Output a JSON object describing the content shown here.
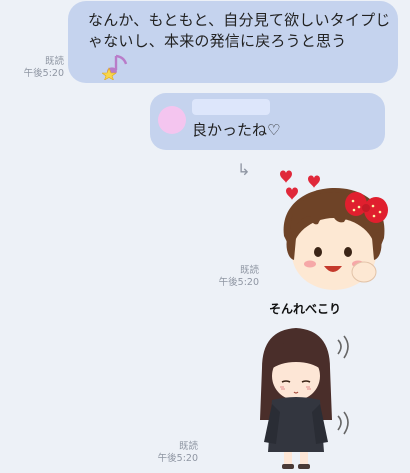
{
  "messages": [
    {
      "text": "なんか、もともと、自分見て欲しいタイプじゃないし、本来の発信に戻ろうと思う",
      "read": "既読",
      "time": "午後5:20"
    },
    {
      "reply_text": "良かったね♡"
    },
    {
      "sticker": "girl-with-strawberry-bow-hearts-sticker",
      "read": "既読",
      "time": "午後5:20"
    },
    {
      "sticker": "girl-sweater-bowing-sticker",
      "caption": "そんれべこり",
      "read": "既読",
      "time": "午後5:20"
    }
  ],
  "colors": {
    "background": "#edf1f7",
    "bubble": "#c5d3ee",
    "meta": "#8f96a3"
  }
}
